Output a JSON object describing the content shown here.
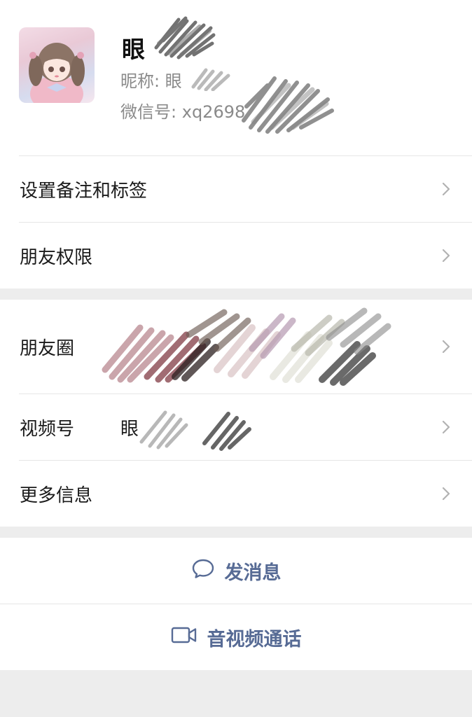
{
  "profile": {
    "display_name": "眼",
    "nickname_label": "昵称:",
    "nickname_value": "眼",
    "wechat_id_label": "微信号:",
    "wechat_id_value": "xq2698"
  },
  "menu1": {
    "remark": "设置备注和标签",
    "permissions": "朋友权限"
  },
  "menu2": {
    "moments": "朋友圈",
    "channels": "视频号",
    "channels_value": "眼",
    "more": "更多信息"
  },
  "actions": {
    "message": "发消息",
    "call": "音视频通话"
  },
  "colors": {
    "accent": "#576b95",
    "background": "#ededed",
    "card": "#ffffff"
  },
  "icons": {
    "message": "chat-bubble-icon",
    "call": "video-camera-icon",
    "chevron": "chevron-right-icon"
  }
}
